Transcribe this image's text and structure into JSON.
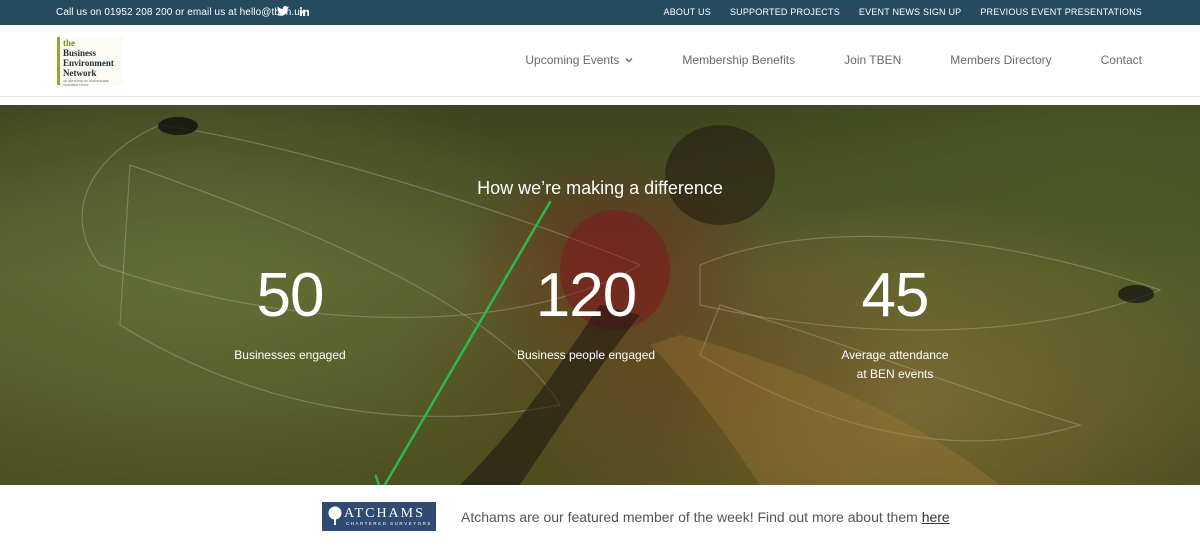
{
  "topbar": {
    "contact_prefix": "Call us on",
    "phone": "01952 208 200",
    "contact_mid": "or email us at",
    "email": "hello@tben.uk",
    "links": [
      "ABOUT US",
      "SUPPORTED PROJECTS",
      "EVENT NEWS SIGN UP",
      "PREVIOUS EVENT PRESENTATIONS"
    ]
  },
  "logo": {
    "lines": [
      "the",
      "Business",
      "Environment",
      "Network"
    ],
    "tagline": "AN INITIATIVE OF SHROPSHIRE CHAMBER TRUST"
  },
  "nav": {
    "items": [
      "Upcoming Events",
      "Membership Benefits",
      "Join TBEN",
      "Members Directory",
      "Contact"
    ]
  },
  "hero": {
    "title": "How we’re making a difference",
    "stats": [
      {
        "value": "50",
        "label": "Businesses engaged"
      },
      {
        "value": "120",
        "label": "Business people engaged"
      },
      {
        "value": "45",
        "label": "Average attendance at BEN events"
      }
    ]
  },
  "featured": {
    "logo_name": "ATCHAMS",
    "logo_sub": "CHARTERED SURVEYORS",
    "text": "Atchams are our featured member of the week! Find out more about them",
    "link": "here"
  },
  "colors": {
    "topbar": "#264b5e",
    "logo_accent": "#9aa23a",
    "atchams_blue": "#2f4a73",
    "annotation_arrow": "#2db84a"
  }
}
